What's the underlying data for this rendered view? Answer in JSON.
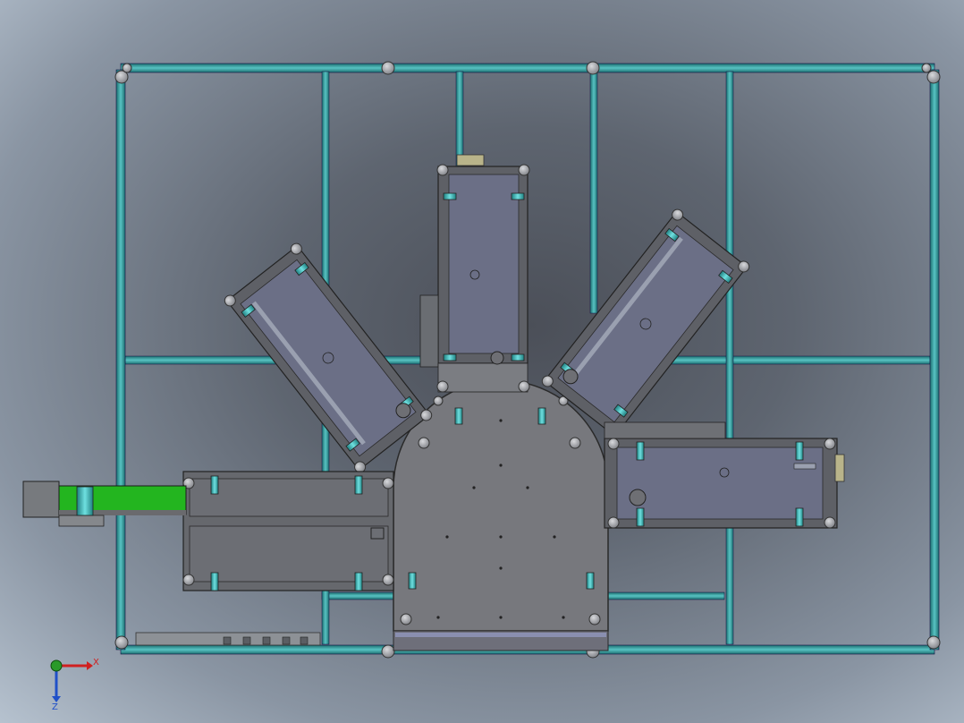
{
  "viewport": {
    "background_center": "#4b4f58",
    "background_edge": "#b6c2cf",
    "frame_color": "#2f8f8f",
    "frame_highlight": "#6fd3d3",
    "panel_fill": "#6f7076",
    "plate_fill": "#78797e",
    "station_fill": "#5f6167",
    "station_inner": "#6b6f86",
    "accent_cyan": "#3aa8a8",
    "conveyor_belt": "#23b51f",
    "node_fill": "#9b9da2"
  },
  "triad": {
    "x_label": "X",
    "z_label": "Z",
    "x_color": "#d02020",
    "z_color": "#2050c8",
    "origin_color": "#2a9a2a"
  },
  "model": {
    "stations": [
      "station-top",
      "station-upper-left",
      "station-upper-right",
      "station-left",
      "station-right"
    ],
    "has_input_conveyor": true,
    "has_rotary_base": true
  }
}
